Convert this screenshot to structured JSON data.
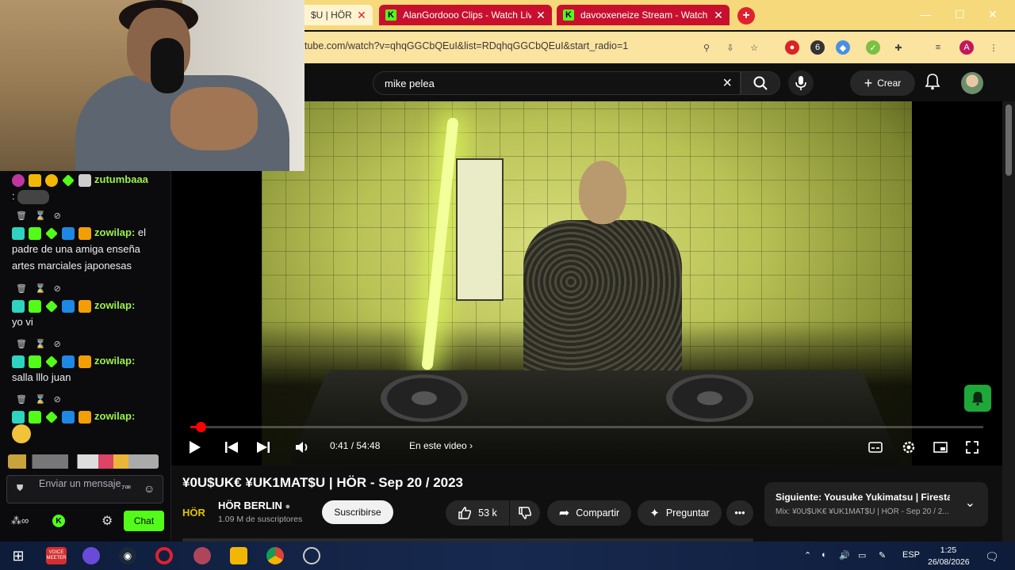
{
  "browser": {
    "tabs": [
      {
        "label": "$U | HÖR - ",
        "active": true
      },
      {
        "label": "AlanGordooo Clips - Watch Live",
        "active": false
      },
      {
        "label": "davooxeneize Stream - Watch",
        "active": false
      }
    ],
    "url": "tube.com/watch?v=qhqGGCbQEuI&list=RDqhqGGCbQEuI&start_radio=1"
  },
  "youtube": {
    "search_value": "mike pelea",
    "create_label": "Crear",
    "player": {
      "time": "0:41 / 54:48",
      "chapter_label": "En este video",
      "progress": 0.0125
    },
    "video_title": "¥0U$UK€ ¥UK1MAT$U | HÖR - Sep 20 / 2023",
    "channel": {
      "logo_text": "HÖR",
      "name": "HÖR BERLIN",
      "subscribers": "1.09 M de suscriptores"
    },
    "subscribe_label": "Suscribirse",
    "likes": "53 k",
    "share_label": "Compartir",
    "ask_label": "Preguntar",
    "next": {
      "title": "Siguiente: Yousuke Yukimatsu | Firestar...",
      "subtitle": "Mix: ¥0U$UK€ ¥UK1MAT$U | HÖR - Sep 20 / 2..."
    }
  },
  "chat": {
    "messages": [
      {
        "user": "zutumbaaa",
        "text": ":"
      },
      {
        "user": "zowilap:",
        "text": "el padre de una amiga enseña artes marciales japonesas"
      },
      {
        "user": "zowilap:",
        "text": "yo vi"
      },
      {
        "user": "zowilap:",
        "text": "salla lllo juan"
      },
      {
        "user": "zowilap:",
        "text": ""
      }
    ],
    "input_placeholder": "Enviar un mensaje",
    "chat_button": "Chat",
    "brand_color": "#53fc18"
  },
  "taskbar": {
    "lang": "ESP",
    "time": "1:25",
    "date": "26/08/2026",
    "voice_label": "VOICE MEETER"
  }
}
